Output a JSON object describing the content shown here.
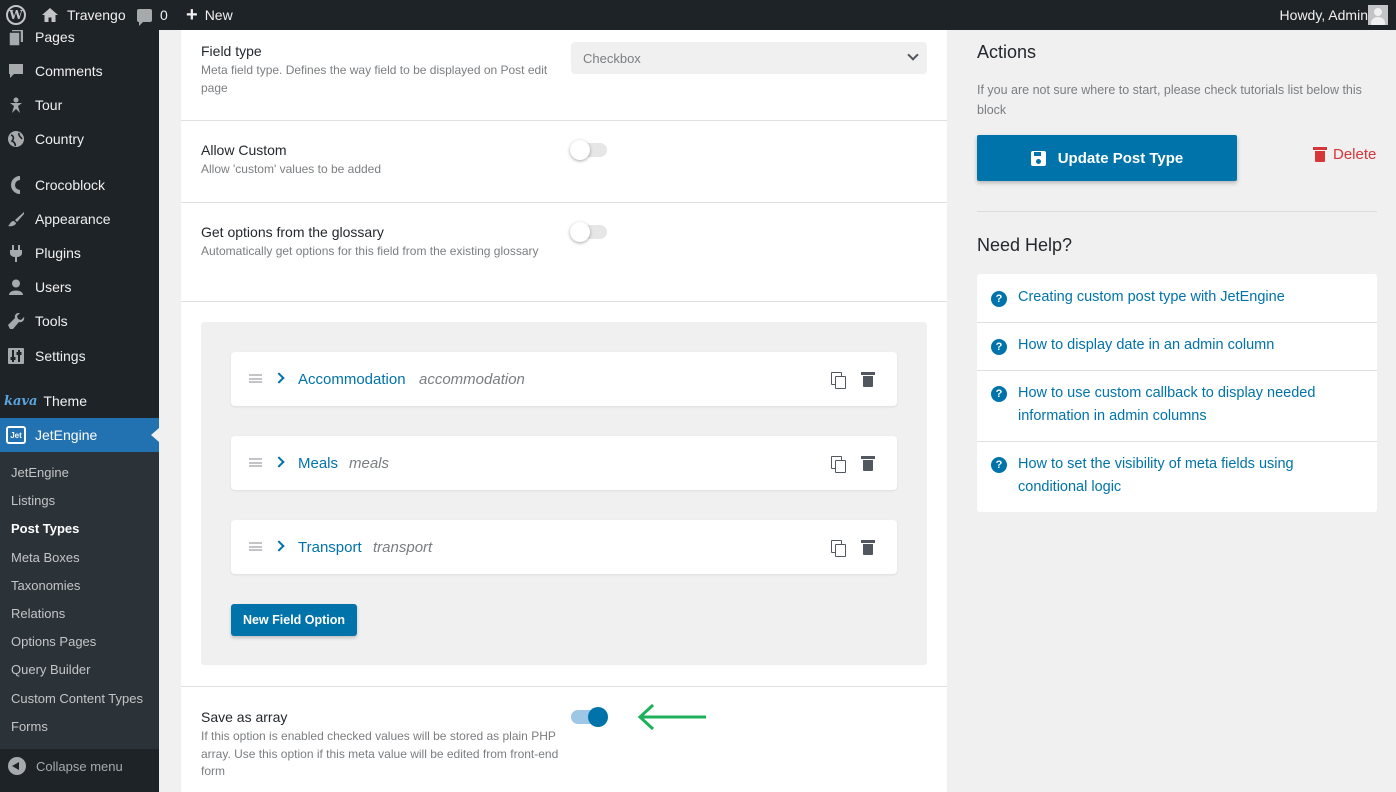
{
  "adminbar": {
    "site_name": "Travengo",
    "comments_count": "0",
    "new_label": "New",
    "howdy": "Howdy, Admin"
  },
  "sidebar": {
    "items": [
      {
        "label": "Pages",
        "icon": "pages-icon"
      },
      {
        "label": "Comments",
        "icon": "comments-icon"
      },
      {
        "label": "Tour",
        "icon": "pin-icon"
      },
      {
        "label": "Country",
        "icon": "globe-icon"
      },
      {
        "label": "Crocoblock",
        "icon": "crocoblock-icon"
      },
      {
        "label": "Appearance",
        "icon": "brush-icon"
      },
      {
        "label": "Plugins",
        "icon": "plug-icon"
      },
      {
        "label": "Users",
        "icon": "user-icon"
      },
      {
        "label": "Tools",
        "icon": "wrench-icon"
      },
      {
        "label": "Settings",
        "icon": "sliders-icon"
      },
      {
        "label": "Theme",
        "prefix": "kava",
        "icon": "kava-logo"
      },
      {
        "label": "JetEngine",
        "icon": "jetengine-icon"
      }
    ],
    "submenu": [
      "JetEngine",
      "Listings",
      "Post Types",
      "Meta Boxes",
      "Taxonomies",
      "Relations",
      "Options Pages",
      "Query Builder",
      "Custom Content Types",
      "Forms"
    ],
    "current_submenu": "Post Types",
    "collapse_label": "Collapse menu"
  },
  "field": {
    "type_label": "Field type",
    "type_desc": "Meta field type. Defines the way field to be displayed on Post edit page",
    "type_value": "Checkbox",
    "allow_custom_label": "Allow Custom",
    "allow_custom_desc": "Allow 'custom' values to be added",
    "allow_custom_on": false,
    "glossary_label": "Get options from the glossary",
    "glossary_desc": "Automatically get options for this field from the existing glossary",
    "glossary_on": false,
    "options": [
      {
        "label": "Accommodation",
        "value": "accommodation"
      },
      {
        "label": "Meals",
        "value": "meals"
      },
      {
        "label": "Transport",
        "value": "transport"
      }
    ],
    "new_option_label": "New Field Option",
    "save_array_label": "Save as array",
    "save_array_desc": "If this option is enabled checked values will be stored as plain PHP array. Use this option if this meta value will be edited from front-end form",
    "save_array_on": true
  },
  "actions": {
    "title": "Actions",
    "hint": "If you are not sure where to start, please check tutorials list below this block",
    "update_label": "Update Post Type",
    "delete_label": "Delete"
  },
  "help": {
    "title": "Need Help?",
    "links": [
      "Creating custom post type with JetEngine",
      "How to display date in an admin column",
      "How to use custom callback to display needed information in admin columns",
      "How to set the visibility of meta fields using conditional logic"
    ]
  },
  "colors": {
    "accent": "#0073aa",
    "danger": "#d63638",
    "sidebar_bg": "#1d2327",
    "arrow": "#1eb05a"
  }
}
